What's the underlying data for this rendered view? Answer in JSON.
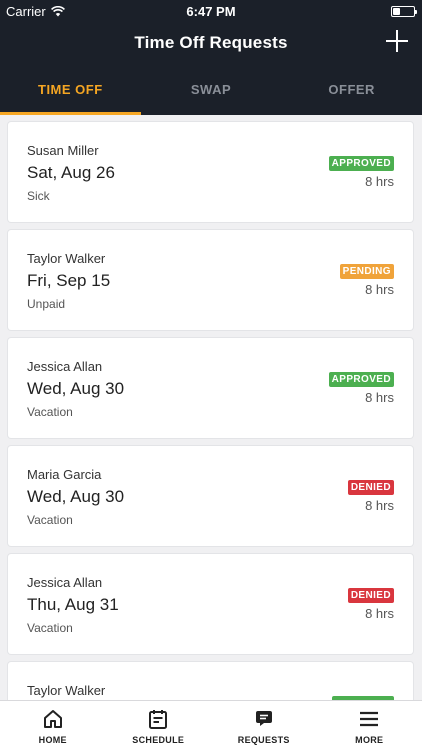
{
  "status_bar": {
    "carrier": "Carrier",
    "time": "6:47 PM"
  },
  "navbar": {
    "title": "Time Off Requests",
    "add_icon": "plus-icon"
  },
  "tabs": [
    {
      "label": "TIME OFF",
      "active": true
    },
    {
      "label": "SWAP",
      "active": false
    },
    {
      "label": "OFFER",
      "active": false
    }
  ],
  "requests": [
    {
      "name": "Susan Miller",
      "date": "Sat, Aug 26",
      "type": "Sick",
      "status": "APPROVED",
      "status_color": "#4caf50",
      "hours": "8 hrs"
    },
    {
      "name": "Taylor Walker",
      "date": "Fri, Sep 15",
      "type": "Unpaid",
      "status": "PENDING",
      "status_color": "#f0a33a",
      "hours": "8 hrs"
    },
    {
      "name": "Jessica Allan",
      "date": "Wed, Aug 30",
      "type": "Vacation",
      "status": "APPROVED",
      "status_color": "#4caf50",
      "hours": "8 hrs"
    },
    {
      "name": "Maria Garcia",
      "date": "Wed, Aug 30",
      "type": "Vacation",
      "status": "DENIED",
      "status_color": "#d9363e",
      "hours": "8 hrs"
    },
    {
      "name": "Jessica Allan",
      "date": "Thu, Aug 31",
      "type": "Vacation",
      "status": "DENIED",
      "status_color": "#d9363e",
      "hours": "8 hrs"
    },
    {
      "name": "Taylor Walker",
      "date": "",
      "type": "",
      "status": "",
      "status_color": "#4caf50",
      "hours": ""
    }
  ],
  "bottom_nav": [
    {
      "label": "HOME",
      "icon": "home-icon"
    },
    {
      "label": "SCHEDULE",
      "icon": "schedule-icon"
    },
    {
      "label": "REQUESTS",
      "icon": "requests-icon"
    },
    {
      "label": "MORE",
      "icon": "menu-icon"
    }
  ],
  "colors": {
    "header_bg": "#1b2029",
    "accent": "#f5a623",
    "approved": "#4caf50",
    "pending": "#f0a33a",
    "denied": "#d9363e"
  }
}
